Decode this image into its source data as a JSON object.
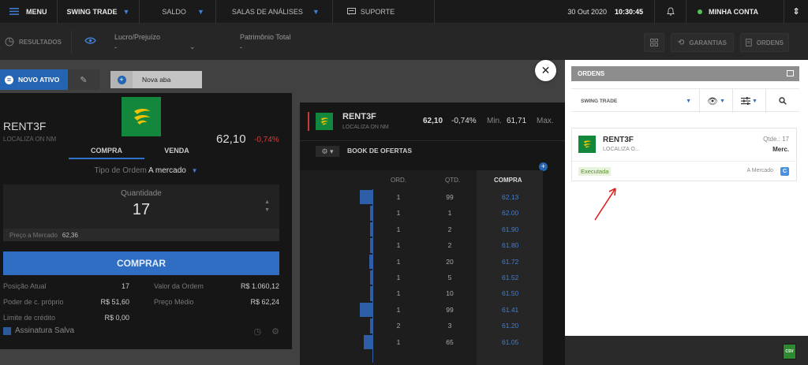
{
  "topbar": {
    "menu": "MENU",
    "mode": "SWING TRADE",
    "saldo": "SALDO",
    "salas": "SALAS DE ANÁLISES",
    "suporte": "SUPORTE",
    "date": "30 Out 2020",
    "time": "10:30:45",
    "account": "MINHA CONTA"
  },
  "subbar": {
    "resultados": "RESULTADOS",
    "lucro_label": "Lucro/Prejuízo",
    "lucro_value": "-",
    "patrimonio_label": "Patrimônio Total",
    "patrimonio_value": "-",
    "garantias": "GARANTIAS",
    "ordens": "ORDENS"
  },
  "tabs": {
    "new": "NOVO ATIVO",
    "aba": "Nova aba"
  },
  "order_panel": {
    "ticker": "RENT3F",
    "name": "LOCALIZA ON NM",
    "price": "62,10",
    "change": "-0,74%",
    "tab_buy": "COMPRA",
    "tab_sell": "VENDA",
    "tipo_label": "Tipo de Ordem",
    "tipo_value": "A mercado",
    "qty_label": "Quantidade",
    "qty_value": "17",
    "mkt_label": "Preço a Mercado",
    "mkt_value": "62,36",
    "buy_button": "COMPRAR",
    "posicao_label": "Posição Atual",
    "posicao_value": "17",
    "valor_label": "Valor da Ordem",
    "valor_value": "R$ 1.060,12",
    "poder_label": "Poder de c. próprio",
    "poder_value": "R$ 51,60",
    "medio_label": "Preço Médio",
    "medio_value": "R$ 62,24",
    "limite_label": "Limite de crédito",
    "limite_value": "R$ 0,00",
    "assinatura": "Assinatura Salva"
  },
  "book": {
    "ticker": "RENT3F",
    "name": "LOCALIZA ON NM",
    "price": "62,10",
    "change": "-0,74%",
    "min_label": "Min.",
    "min_value": "61,71",
    "max_label": "Max.",
    "title": "BOOK DE OFERTAS",
    "headers": {
      "ord": "ORD.",
      "qtd": "QTD.",
      "compra": "COMPRA"
    },
    "rows": [
      {
        "ord": "1",
        "qtd": "99",
        "compra": "62.13",
        "bar": 0.9
      },
      {
        "ord": "1",
        "qtd": "1",
        "compra": "62.00",
        "bar": 0.1
      },
      {
        "ord": "1",
        "qtd": "2",
        "compra": "61.90",
        "bar": 0.1
      },
      {
        "ord": "1",
        "qtd": "2",
        "compra": "61.80",
        "bar": 0.1
      },
      {
        "ord": "1",
        "qtd": "20",
        "compra": "61.72",
        "bar": 0.2
      },
      {
        "ord": "1",
        "qtd": "5",
        "compra": "61.52",
        "bar": 0.1
      },
      {
        "ord": "1",
        "qtd": "10",
        "compra": "61.50",
        "bar": 0.15
      },
      {
        "ord": "1",
        "qtd": "99",
        "compra": "61.41",
        "bar": 0.9
      },
      {
        "ord": "2",
        "qtd": "3",
        "compra": "61.20",
        "bar": 0.1
      },
      {
        "ord": "1",
        "qtd": "65",
        "compra": "61.05",
        "bar": 0.6
      }
    ]
  },
  "orders": {
    "title": "ORDENS",
    "filter": "SWING TRADE",
    "card": {
      "ticker": "RENT3F",
      "name": "LOCALIZA O...",
      "qtde": "Qtde.: 17",
      "type_short": "Merc.",
      "status": "Executada",
      "tipo": "A Mercado",
      "badge": "C"
    },
    "csv": "CSV"
  },
  "colors": {
    "accent": "#2f6ec2",
    "negative": "#d93a3a",
    "executed": "#5d8d2e",
    "logo": "#13883d"
  }
}
